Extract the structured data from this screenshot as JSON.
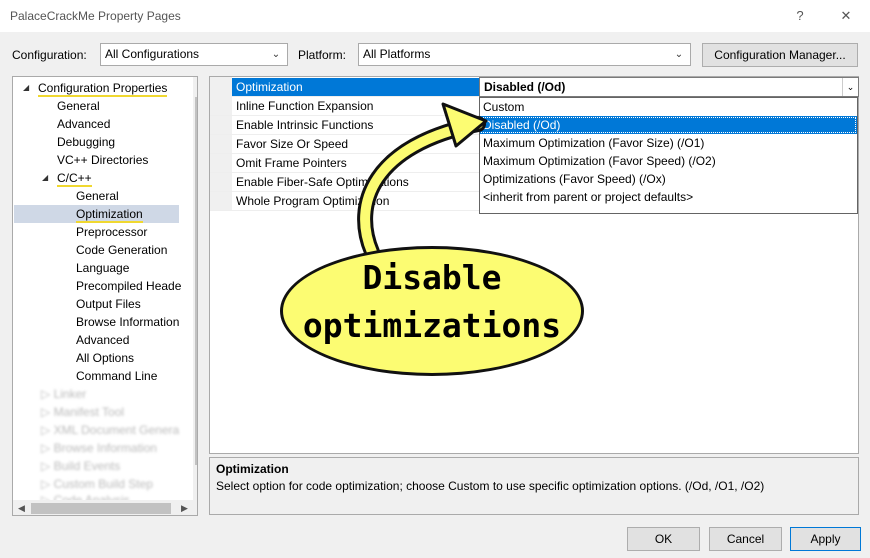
{
  "window": {
    "title": "PalaceCrackMe Property Pages",
    "help_glyph": "?",
    "close_glyph": "✕"
  },
  "toolbar": {
    "configuration_label": "Configuration:",
    "configuration_value": "All Configurations",
    "platform_label": "Platform:",
    "platform_value": "All Platforms",
    "config_manager_label": "Configuration Manager..."
  },
  "tree": {
    "root": "Configuration Properties",
    "items": [
      "General",
      "Advanced",
      "Debugging",
      "VC++ Directories"
    ],
    "cpp": {
      "label": "C/C++",
      "children": [
        "General",
        "Optimization",
        "Preprocessor",
        "Code Generation",
        "Language",
        "Precompiled Heade",
        "Output Files",
        "Browse Information",
        "Advanced",
        "All Options",
        "Command Line"
      ]
    },
    "blurred": [
      "Linker",
      "Manifest Tool",
      "XML Document Genera",
      "Browse Information",
      "Build Events",
      "Custom Build Step",
      "Code Analysis"
    ]
  },
  "grid": {
    "rows": [
      "Optimization",
      "Inline Function Expansion",
      "Enable Intrinsic Functions",
      "Favor Size Or Speed",
      "Omit Frame Pointers",
      "Enable Fiber-Safe Optimizations",
      "Whole Program Optimization"
    ],
    "selected_value": "Disabled (/Od)"
  },
  "dropdown": {
    "options": [
      "Custom",
      "Disabled (/Od)",
      "Maximum Optimization (Favor Size) (/O1)",
      "Maximum Optimization (Favor Speed) (/O2)",
      "Optimizations (Favor Speed) (/Ox)",
      "<inherit from parent or project defaults>"
    ],
    "highlighted": "Disabled (/Od)"
  },
  "description": {
    "title": "Optimization",
    "text": "Select option for code optimization; choose Custom to use specific optimization options.    (/Od, /O1, /O2)"
  },
  "buttons": {
    "ok": "OK",
    "cancel": "Cancel",
    "apply": "Apply"
  },
  "callout": {
    "line1": "Disable",
    "line2": "optimizations"
  },
  "colors": {
    "accent": "#0078d7",
    "callout_fill": "#fcfc72",
    "underline": "#f0d830"
  }
}
